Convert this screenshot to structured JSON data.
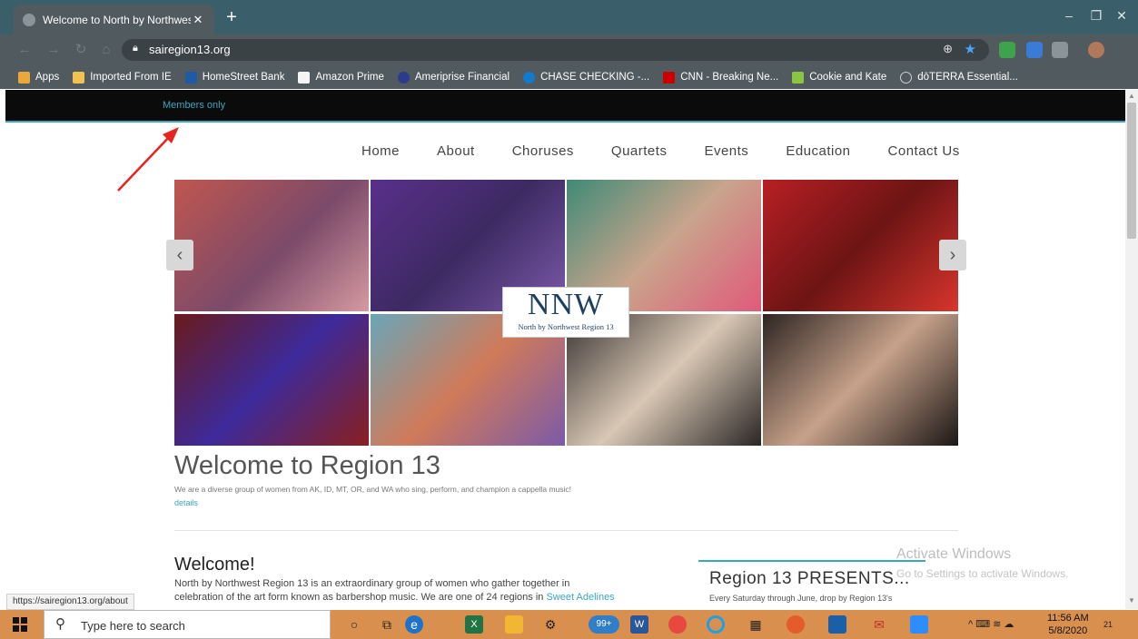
{
  "browser": {
    "tab_title": "Welcome to North by Northwest",
    "tab_close": "✕",
    "new_tab": "+",
    "url": "sairegion13.org",
    "window_controls": {
      "minimize": "–",
      "restore": "❐",
      "close": "✕"
    }
  },
  "bookmarks": [
    {
      "label": "Apps",
      "icon": "apps-grid-icon",
      "color": "#e8a83a"
    },
    {
      "label": "Imported From IE",
      "icon": "folder-icon",
      "color": "#f2c14e"
    },
    {
      "label": "HomeStreet Bank",
      "icon": "bank-icon",
      "color": "#1f5aa6"
    },
    {
      "label": "Amazon Prime",
      "icon": "amazon-icon",
      "color": "#222222"
    },
    {
      "label": "Ameriprise Financial",
      "icon": "ameriprise-icon",
      "color": "#2b3c8f"
    },
    {
      "label": "CHASE CHECKING -...",
      "icon": "chase-icon",
      "color": "#117aca"
    },
    {
      "label": "CNN - Breaking Ne...",
      "icon": "cnn-icon",
      "color": "#cc0000"
    },
    {
      "label": "Cookie and Kate",
      "icon": "cookie-kate-icon",
      "color": "#8cc63f"
    },
    {
      "label": "dōTERRA Essential...",
      "icon": "doterra-icon",
      "color": "#cfcfcf"
    }
  ],
  "site": {
    "members_only": "Members only",
    "nav": [
      "Home",
      "About",
      "Choruses",
      "Quartets",
      "Events",
      "Education",
      "Contact Us"
    ],
    "logo_big": "NNW",
    "logo_small": "North by Northwest Region 13",
    "carousel_prev": "‹",
    "carousel_next": "›",
    "welcome_title": "Welcome to Region 13",
    "welcome_sub": "We are a diverse group of women from AK, ID, MT, OR, and WA who sing, perform, and champion a cappella music!",
    "details": "details",
    "welcome2": "Welcome!",
    "welcome_body_1": "North by Northwest Region 13 is an extraordinary group of women who gather together in",
    "welcome_body_2": "celebration of the art form known as barbershop music. We are one of 24 regions in ",
    "welcome_body_link": "Sweet Adelines",
    "presents_title": "Region 13 PRESENTS...",
    "presents_body": "Every Saturday through June, drop by Region 13's"
  },
  "overlay": {
    "activate_title": "Activate Windows",
    "activate_sub": "Go to Settings to activate Windows.",
    "status_url": "https://sairegion13.org/about"
  },
  "taskbar": {
    "search_placeholder": "Type here to search",
    "badge_count": "99+",
    "time": "11:56 AM",
    "date": "5/8/2020",
    "notification_count": "21"
  },
  "colors": {
    "accent": "#3aa7bf",
    "taskbar": "#d98f4e",
    "chrome": "#505a5f"
  }
}
